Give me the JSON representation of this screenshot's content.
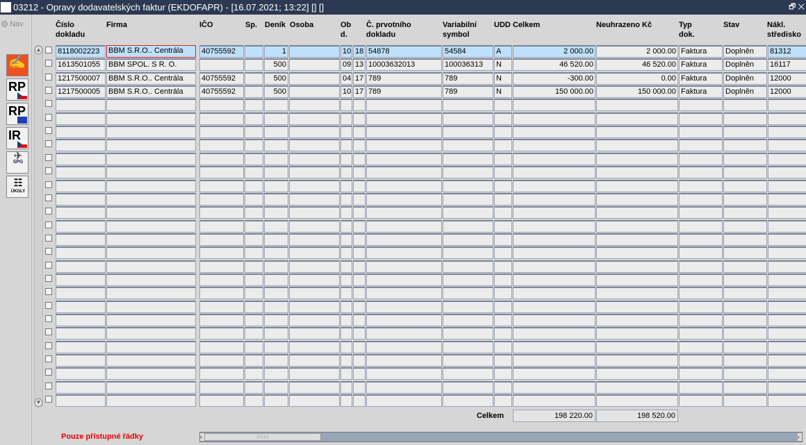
{
  "window": {
    "title": "03212 - Opravy dodavatelských faktur (EKDOFAPR) - [16.07.2021; 13:22]  [] []",
    "logo": "IF"
  },
  "toolbar": {
    "nav_label": "Nav",
    "buttons": [
      {
        "icon": "edit-document-icon",
        "label": ""
      },
      {
        "icon": "rp-cz-icon",
        "label": "RP"
      },
      {
        "icon": "rp-eu-icon",
        "label": "RP"
      },
      {
        "icon": "ir-cz-icon",
        "label": "IR"
      },
      {
        "icon": "spg-plane-icon",
        "label": "SPG"
      },
      {
        "icon": "tasks-icon",
        "label": "ÚKOLY"
      }
    ]
  },
  "columns": [
    {
      "key": "cislo",
      "label": "Číslo\ndokladu"
    },
    {
      "key": "firma",
      "label": "Firma"
    },
    {
      "key": "ico",
      "label": "IČO"
    },
    {
      "key": "sp",
      "label": "Sp."
    },
    {
      "key": "denik",
      "label": "Deník"
    },
    {
      "key": "osoba",
      "label": "Osoba"
    },
    {
      "key": "ob",
      "label": "Ob\nd."
    },
    {
      "key": "d",
      "label": ""
    },
    {
      "key": "prvotni",
      "label": "Č. prvotního\ndokladu"
    },
    {
      "key": "vs",
      "label": "Variabilní\nsymbol"
    },
    {
      "key": "udd",
      "label": "UDD"
    },
    {
      "key": "celkem",
      "label": "Celkem"
    },
    {
      "key": "neuhr",
      "label": "Neuhrazeno Kč"
    },
    {
      "key": "typ",
      "label": "Typ\ndok."
    },
    {
      "key": "stav",
      "label": "Stav"
    },
    {
      "key": "nakl",
      "label": "Nákl.\nstředisko"
    }
  ],
  "rows": [
    {
      "cislo": "8118002223",
      "firma": "BBM S.R.O.. Centrála",
      "ico": "40755592",
      "sp": "",
      "denik": "1",
      "osoba": "",
      "ob": "10",
      "d": "18",
      "prvotni": "54878",
      "vs": "54584",
      "udd": "A",
      "celkem": "2 000.00",
      "neuhr": "2 000.00",
      "typ": "Faktura",
      "stav": "Doplněn",
      "nakl": "81312"
    },
    {
      "cislo": "1613501055",
      "firma": "BBM SPOL. S R. O.",
      "ico": "",
      "sp": "",
      "denik": "500",
      "osoba": "",
      "ob": "09",
      "d": "13",
      "prvotni": "10003632013",
      "vs": "100036313",
      "udd": "N",
      "celkem": "46 520.00",
      "neuhr": "46 520.00",
      "typ": "Faktura",
      "stav": "Doplněn",
      "nakl": "16117"
    },
    {
      "cislo": "1217500007",
      "firma": "BBM S.R.O.. Centrála",
      "ico": "40755592",
      "sp": "",
      "denik": "500",
      "osoba": "",
      "ob": "04",
      "d": "17",
      "prvotni": "789",
      "vs": "789",
      "udd": "N",
      "celkem": "-300.00",
      "neuhr": "0.00",
      "typ": "Faktura",
      "stav": "Doplněn",
      "nakl": "12000"
    },
    {
      "cislo": "1217500005",
      "firma": "BBM S.R.O.. Centrála",
      "ico": "40755592",
      "sp": "",
      "denik": "500",
      "osoba": "",
      "ob": "10",
      "d": "17",
      "prvotni": "789",
      "vs": "789",
      "udd": "N",
      "celkem": "150 000.00",
      "neuhr": "150 000.00",
      "typ": "Faktura",
      "stav": "Doplněn",
      "nakl": "12000"
    }
  ],
  "totals": {
    "label": "Celkem",
    "celkem": "198 220.00",
    "neuhr": "198 520.00"
  },
  "footer": {
    "note": "Pouze přístupné řádky"
  }
}
